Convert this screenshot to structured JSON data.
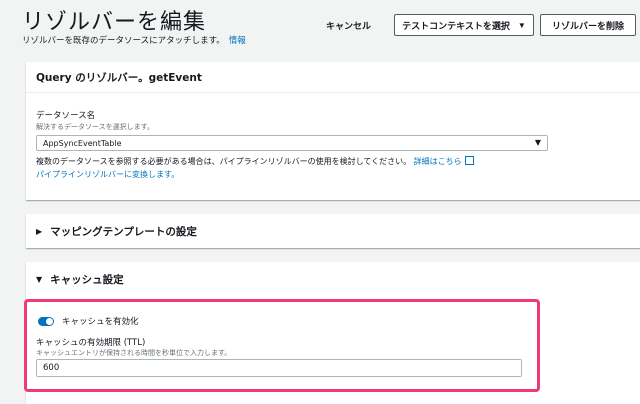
{
  "header": {
    "title": "リゾルバーを編集",
    "subtitle": "リゾルバーを既存のデータソースにアタッチします。",
    "info_link": "情報",
    "cancel_label": "キャンセル",
    "context_button_label": "テストコンテキストを選択",
    "delete_button_label": "リゾルバーを削除"
  },
  "resolver_panel": {
    "title": "Query のリゾルバー。getEvent",
    "datasource_label": "データソース名",
    "datasource_desc": "解決するデータソースを選択します。",
    "datasource_value": "AppSyncEventTable",
    "help_text": "複数のデータソースを参照する必要がある場合は、パイプラインリゾルバーの使用を検討してください。",
    "help_link": "詳細はこちら",
    "convert_link": "パイプラインリゾルバーに変換します。"
  },
  "mapping_panel": {
    "title": "マッピングテンプレートの設定",
    "expanded": false
  },
  "cache_panel": {
    "title": "キャッシュ設定",
    "expanded": true,
    "enable_label": "キャッシュを有効化",
    "enabled": true,
    "ttl_label": "キャッシュの有効期限 (TTL)",
    "ttl_desc": "キャッシュエントリが保持される時間を秒単位で入力します。",
    "ttl_value": "600"
  },
  "colors": {
    "accent": "#0073bb",
    "highlight": "#ee3a75",
    "background": "#f2f3f3"
  }
}
